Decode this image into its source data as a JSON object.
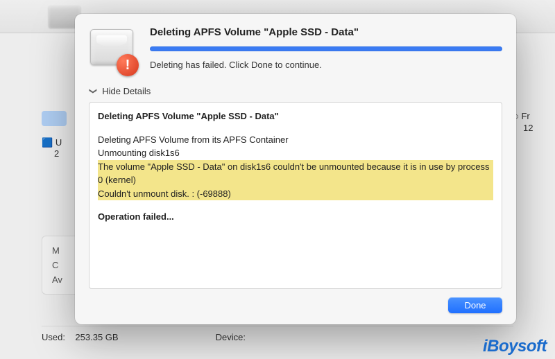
{
  "modal": {
    "title": "Deleting APFS Volume \"Apple SSD - Data\"",
    "subtitle": "Deleting has failed. Click Done to continue.",
    "toggle_label": "Hide Details",
    "done_label": "Done",
    "alert_glyph": "!"
  },
  "log": {
    "line1": "Deleting APFS Volume \"Apple SSD - Data\"",
    "line2": "Deleting APFS Volume from its APFS Container",
    "line3": "Unmounting disk1s6",
    "hi1": "The volume \"Apple SSD - Data\" on disk1s6 couldn't be unmounted because it is in use by process 0 (kernel)",
    "hi2": "Couldn't unmount disk. : (-69888)",
    "fail": "Operation failed..."
  },
  "bg": {
    "u_label": "U",
    "u_sub": "2",
    "fr_label": "Fr",
    "fr_val": "12",
    "m_label": "M",
    "c_label": "C",
    "av_label": "Av",
    "used_label": "Used:",
    "used_val": "253.35 GB",
    "device_label": "Device:"
  },
  "watermark": "iBoysoft"
}
